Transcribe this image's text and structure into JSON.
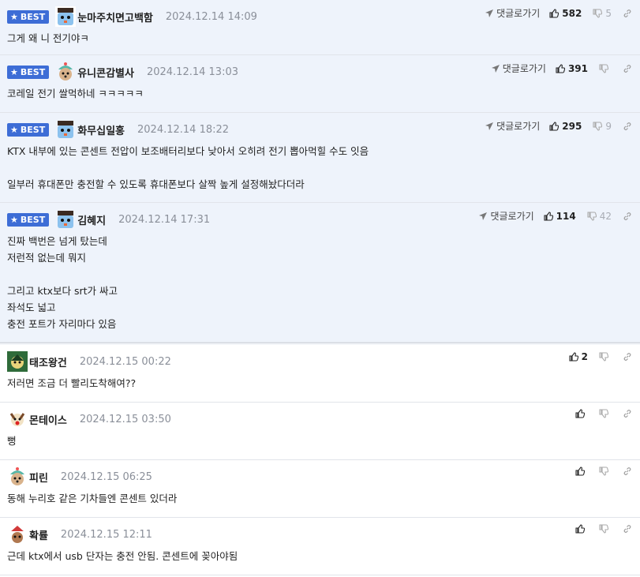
{
  "comments": [
    {
      "best": true,
      "badge": "BEST",
      "nick": "눈마주치면고백함",
      "time": "2024.12.14 14:09",
      "reply": "댓글로가기",
      "up": "582",
      "down": "5",
      "text": "그게 왜 니 전기야ㅋ"
    },
    {
      "best": true,
      "badge": "BEST",
      "nick": "유니콘감별사",
      "time": "2024.12.14 13:03",
      "reply": "댓글로가기",
      "up": "391",
      "down": "",
      "text": "코레일 전기 쌀먹하네 ㅋㅋㅋㅋㅋ"
    },
    {
      "best": true,
      "badge": "BEST",
      "nick": "화무십일홍",
      "time": "2024.12.14 18:22",
      "reply": "댓글로가기",
      "up": "295",
      "down": "9",
      "text": "KTX 내부에 있는 콘센트 전압이 보조배터리보다 낮아서 오히려 전기 뽑아먹힐 수도 잇음\n\n일부러 휴대폰만 충전할 수 있도록 휴대폰보다 살짝 높게 설정해놨다더라"
    },
    {
      "best": true,
      "badge": "BEST",
      "nick": "김혜지",
      "time": "2024.12.14 17:31",
      "reply": "댓글로가기",
      "up": "114",
      "down": "42",
      "text": "진짜 백번은 넘게 탔는데\n저런적 없는데 뭐지\n\n그리고 ktx보다 srt가 싸고\n좌석도 넓고\n충전 포트가 자리마다 있음"
    },
    {
      "best": false,
      "nick": "태조왕건",
      "time": "2024.12.15 00:22",
      "up": "2",
      "down": "",
      "text": "저러면 조금 더 빨리도착해여??"
    },
    {
      "best": false,
      "nick": "몬테이스",
      "time": "2024.12.15 03:50",
      "up": "",
      "down": "",
      "text": "뻥"
    },
    {
      "best": false,
      "nick": "피린",
      "time": "2024.12.15 06:25",
      "up": "",
      "down": "",
      "text": "동해 누리호 같은 기차들엔 콘센트 있더라"
    },
    {
      "best": false,
      "nick": "확률",
      "time": "2024.12.15 12:11",
      "up": "",
      "down": "",
      "text": "근데 ktx에서 usb 단자는 충전 안됨. 콘센트에 꽂아야됨"
    }
  ]
}
